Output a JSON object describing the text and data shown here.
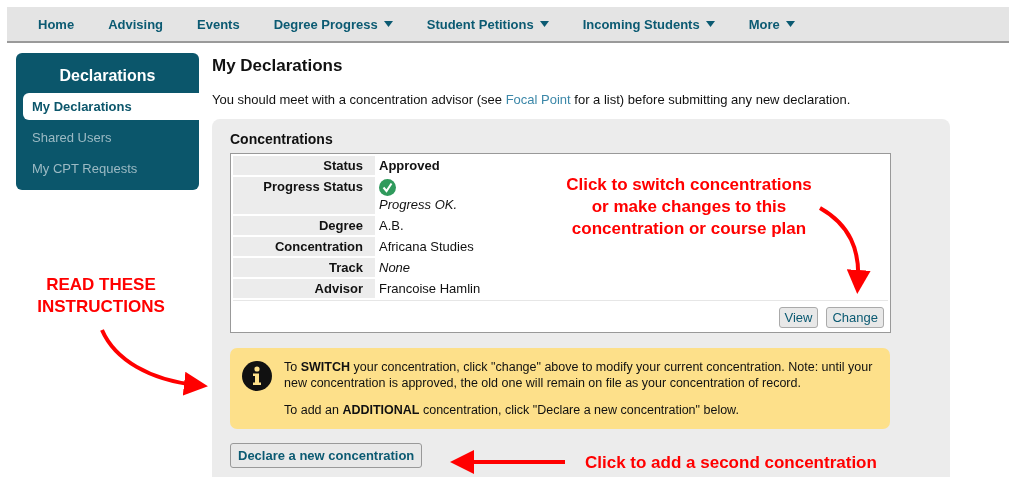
{
  "nav": [
    {
      "label": "Home",
      "dropdown": false
    },
    {
      "label": "Advising",
      "dropdown": false
    },
    {
      "label": "Events",
      "dropdown": false
    },
    {
      "label": "Degree Progress",
      "dropdown": true
    },
    {
      "label": "Student Petitions",
      "dropdown": true
    },
    {
      "label": "Incoming Students",
      "dropdown": true
    },
    {
      "label": "More",
      "dropdown": true
    }
  ],
  "sidebar": {
    "title": "Declarations",
    "items": [
      {
        "label": "My Declarations",
        "selected": true
      },
      {
        "label": "Shared Users",
        "selected": false
      },
      {
        "label": "My CPT Requests",
        "selected": false
      }
    ]
  },
  "page_title": "My Declarations",
  "intro": {
    "before": "You should meet with a concentration advisor (see ",
    "link": "Focal Point",
    "after": " for a list) before submitting any new declaration."
  },
  "panel": {
    "title": "Concentrations",
    "rows": [
      {
        "label": "Status",
        "value": "Approved",
        "kind": "bold"
      },
      {
        "label": "Progress Status",
        "value": "Progress OK.",
        "kind": "progress"
      },
      {
        "label": "Degree",
        "value": "A.B.",
        "kind": "plain"
      },
      {
        "label": "Concentration",
        "value": "Africana Studies",
        "kind": "plain"
      },
      {
        "label": "Track",
        "value": "None",
        "kind": "italic"
      },
      {
        "label": "Advisor",
        "value": "Francoise Hamlin",
        "kind": "plain"
      }
    ],
    "buttons": [
      "View",
      "Change"
    ],
    "notice": [
      "To **SWITCH** your concentration, click \"change\" above to modify your current concentration. Note: until your new concentration is approved, the old one will remain on file as your concentration of record.",
      "To add an **ADDITIONAL** concentration, click \"Declare a new concentration\" below."
    ],
    "declare_button": "Declare a new concentration"
  },
  "annotations": [
    "Click to switch concentrations\nor make changes to this\nconcentration or course plan",
    "READ THESE\nINSTRUCTIONS",
    "Click to add a second concentration"
  ]
}
